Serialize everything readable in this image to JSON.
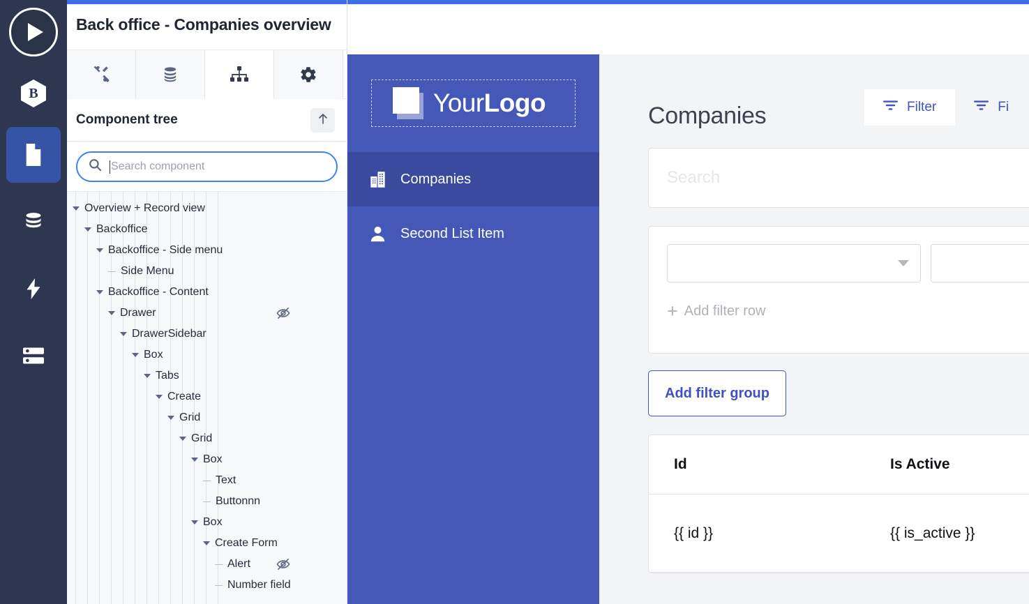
{
  "colors": {
    "top_bar_blue": "#3b6fe8",
    "rail_bg": "#2e3650",
    "rail_active": "#3554a5",
    "app_sidebar": "#4558b8",
    "app_sidebar_selected": "#3b4a9e",
    "accent_indigo": "#3f51c4",
    "search_border": "#3b82f6"
  },
  "rail": {
    "play_button": "play-button",
    "brand_letter": "B",
    "items": [
      {
        "icon": "document-icon",
        "active": true
      },
      {
        "icon": "database-icon",
        "active": false
      },
      {
        "icon": "lightning-bolt-icon",
        "active": false
      },
      {
        "icon": "server-stack-icon",
        "active": false
      }
    ]
  },
  "panel": {
    "title": "Back office - Companies overview",
    "tabs": [
      {
        "icon": "tools-icon",
        "active": false
      },
      {
        "icon": "database-icon",
        "active": false
      },
      {
        "icon": "component-tree-icon",
        "active": true
      },
      {
        "icon": "gear-icon",
        "active": false
      }
    ],
    "tree_header": {
      "label": "Component tree",
      "collapse_icon": "arrow-up-icon"
    },
    "search": {
      "placeholder": "Search component",
      "value": "",
      "icon": "search-icon"
    },
    "tree_nodes": [
      {
        "label": "Overview + Record view",
        "depth": 0,
        "expandable": true,
        "hidden_icon": false
      },
      {
        "label": "Backoffice",
        "depth": 1,
        "expandable": true,
        "hidden_icon": false
      },
      {
        "label": "Backoffice - Side menu",
        "depth": 2,
        "expandable": true,
        "hidden_icon": false
      },
      {
        "label": "Side Menu",
        "depth": 3,
        "expandable": false,
        "hidden_icon": false
      },
      {
        "label": "Backoffice - Content",
        "depth": 2,
        "expandable": true,
        "hidden_icon": false
      },
      {
        "label": "Drawer",
        "depth": 3,
        "expandable": true,
        "hidden_icon": true
      },
      {
        "label": "DrawerSidebar",
        "depth": 4,
        "expandable": true,
        "hidden_icon": false
      },
      {
        "label": "Box",
        "depth": 5,
        "expandable": true,
        "hidden_icon": false
      },
      {
        "label": "Tabs",
        "depth": 6,
        "expandable": true,
        "hidden_icon": false
      },
      {
        "label": "Create",
        "depth": 7,
        "expandable": true,
        "hidden_icon": false
      },
      {
        "label": "Grid",
        "depth": 8,
        "expandable": true,
        "hidden_icon": false
      },
      {
        "label": "Grid",
        "depth": 9,
        "expandable": true,
        "hidden_icon": false
      },
      {
        "label": "Box",
        "depth": 10,
        "expandable": true,
        "hidden_icon": false
      },
      {
        "label": "Text",
        "depth": 11,
        "expandable": false,
        "hidden_icon": false
      },
      {
        "label": "Buttonnn",
        "depth": 11,
        "expandable": false,
        "hidden_icon": false
      },
      {
        "label": "Box",
        "depth": 10,
        "expandable": true,
        "hidden_icon": false
      },
      {
        "label": "Create Form",
        "depth": 11,
        "expandable": true,
        "hidden_icon": false
      },
      {
        "label": "Alert",
        "depth": 12,
        "expandable": false,
        "hidden_icon": true
      },
      {
        "label": "Number field",
        "depth": 12,
        "expandable": false,
        "hidden_icon": false
      }
    ]
  },
  "preview": {
    "logo": {
      "text_light": "Your",
      "text_bold": "Logo"
    },
    "nav_items": [
      {
        "label": "Companies",
        "icon": "building-icon",
        "selected": true
      },
      {
        "label": "Second List Item",
        "icon": "person-icon",
        "selected": false
      }
    ],
    "main": {
      "title": "Companies",
      "filter_buttons": [
        {
          "label": "Filter",
          "icon": "filter-icon"
        },
        {
          "label": "Fi",
          "icon": "filter-icon"
        }
      ],
      "search": {
        "placeholder": "Search",
        "value": ""
      },
      "filter_card": {
        "select_field": {
          "value": "",
          "icon": "chevron-down-icon"
        },
        "select_operator": {
          "value": "",
          "icon": "chevron-down-icon"
        },
        "add_row_label": "Add filter row",
        "add_row_icon": "plus-icon"
      },
      "add_group_label": "Add filter group",
      "table": {
        "columns": [
          "Id",
          "Is Active"
        ],
        "rows": [
          [
            "{{ id }}",
            "{{ is_active }}"
          ]
        ]
      }
    }
  }
}
